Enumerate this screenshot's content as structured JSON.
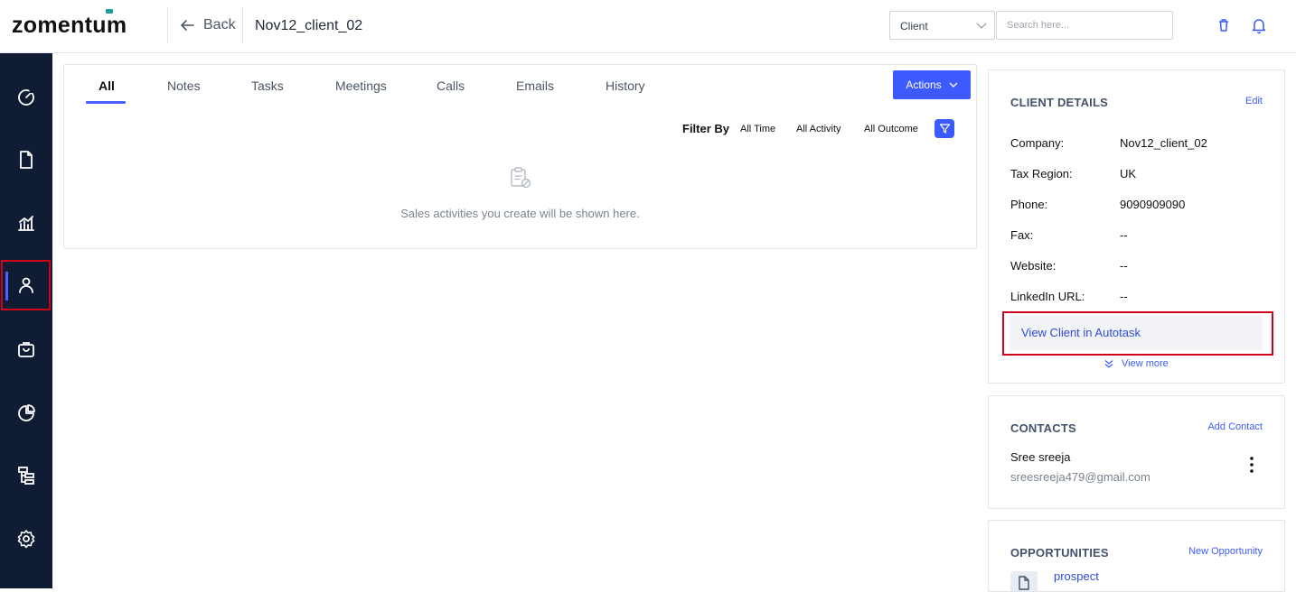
{
  "header": {
    "logo": "zomentum",
    "back_label": "Back",
    "page_title": "Nov12_client_02",
    "entity_select": "Client",
    "search_placeholder": "Search here..."
  },
  "sidebar": {
    "items": [
      {
        "icon": "dashboard-gauge-icon"
      },
      {
        "icon": "document-icon"
      },
      {
        "icon": "reports-chart-icon"
      },
      {
        "icon": "clients-person-icon",
        "active": true
      },
      {
        "icon": "marketplace-bag-icon"
      },
      {
        "icon": "analytics-pie-icon"
      },
      {
        "icon": "hierarchy-icon"
      },
      {
        "icon": "settings-gear-icon"
      }
    ]
  },
  "activity": {
    "tabs": [
      "All",
      "Notes",
      "Tasks",
      "Meetings",
      "Calls",
      "Emails",
      "History"
    ],
    "active_tab": "All",
    "actions_label": "Actions",
    "filter_label": "Filter By",
    "filters": [
      "All Time",
      "All Activity",
      "All Outcome"
    ],
    "empty_message": "Sales activities you create will be shown here."
  },
  "client_details": {
    "title": "CLIENT DETAILS",
    "edit_label": "Edit",
    "fields": [
      {
        "label": "Company:",
        "value": "Nov12_client_02"
      },
      {
        "label": "Tax Region:",
        "value": "UK"
      },
      {
        "label": "Phone:",
        "value": "9090909090"
      },
      {
        "label": "Fax:",
        "value": "--"
      },
      {
        "label": "Website:",
        "value": "--"
      },
      {
        "label": "LinkedIn URL:",
        "value": "--"
      }
    ],
    "autotask_label": "View Client in Autotask",
    "view_more_label": "View more"
  },
  "contacts": {
    "title": "CONTACTS",
    "add_label": "Add Contact",
    "items": [
      {
        "name": "Sree sreeja",
        "email": "sreesreeja479@gmail.com"
      }
    ]
  },
  "opportunities": {
    "title": "OPPORTUNITIES",
    "new_label": "New Opportunity",
    "items": [
      {
        "name": "prospect"
      }
    ]
  },
  "colors": {
    "sidebar_bg": "#0f1c33",
    "accent": "#3d5afe",
    "highlight_border": "#d0021b"
  }
}
